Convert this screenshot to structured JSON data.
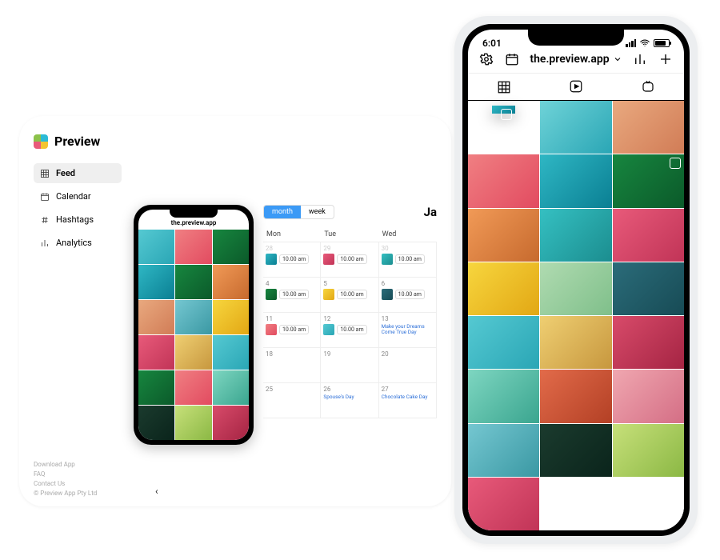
{
  "brand": {
    "name": "Preview"
  },
  "sidebar": {
    "items": [
      {
        "label": "Feed",
        "icon": "grid-icon",
        "active": true
      },
      {
        "label": "Calendar",
        "icon": "calendar-icon",
        "active": false
      },
      {
        "label": "Hashtags",
        "icon": "hash-icon",
        "active": false
      },
      {
        "label": "Analytics",
        "icon": "analytics-icon",
        "active": false
      }
    ]
  },
  "mini_phone": {
    "account": "the.preview.app"
  },
  "calendar": {
    "toggle": {
      "month": "month",
      "week": "week",
      "active": "month"
    },
    "title": "Ja",
    "days": [
      "Mon",
      "Tue",
      "Wed"
    ],
    "rows": [
      [
        {
          "n": "28",
          "muted": true,
          "time": "10.00 am",
          "thumb": "p3"
        },
        {
          "n": "29",
          "muted": true,
          "time": "10.00 am",
          "thumb": "p7"
        },
        {
          "n": "30",
          "muted": true,
          "time": "10.00 am",
          "thumb": "p6"
        }
      ],
      [
        {
          "n": "4",
          "time": "10.00 am",
          "thumb": "p4"
        },
        {
          "n": "5",
          "time": "10.00 am",
          "thumb": "p8"
        },
        {
          "n": "6",
          "time": "10.00 am",
          "thumb": "p10"
        }
      ],
      [
        {
          "n": "11",
          "time": "10.00 am",
          "thumb": "p2"
        },
        {
          "n": "12",
          "time": "10.00 am",
          "thumb": "p11"
        },
        {
          "n": "13",
          "text": "Make your Dreams Come True Day"
        }
      ],
      [
        {
          "n": "18"
        },
        {
          "n": "19"
        },
        {
          "n": "20"
        }
      ],
      [
        {
          "n": "25"
        },
        {
          "n": "26",
          "text": "Spouse's Day"
        },
        {
          "n": "27",
          "text": "Chocolate Cake Day"
        }
      ]
    ]
  },
  "footer": {
    "links": [
      "Download App",
      "FAQ",
      "Contact Us"
    ],
    "copyright": "© Preview App Pty Ltd"
  },
  "phone": {
    "status_time": "6:01",
    "account": "the.preview.app",
    "tabs": [
      "grid",
      "reels",
      "igtv"
    ],
    "feed_palettes": [
      "p0",
      "p1",
      "p2",
      "p3",
      "p4",
      "p5",
      "p6",
      "p7",
      "p8",
      "p9",
      "p10",
      "p11",
      "p12",
      "p13",
      "p14",
      "p15",
      "p17",
      "p16",
      "p19",
      "p18",
      "p7"
    ],
    "reel_index": 4,
    "float_palette": "p3"
  },
  "mini_palettes": [
    "p11",
    "p2",
    "p4",
    "p3",
    "p4",
    "p5",
    "p1",
    "p16",
    "p8",
    "p7",
    "p12",
    "p11",
    "p4",
    "p2",
    "p14",
    "p19",
    "p18",
    "p13"
  ]
}
